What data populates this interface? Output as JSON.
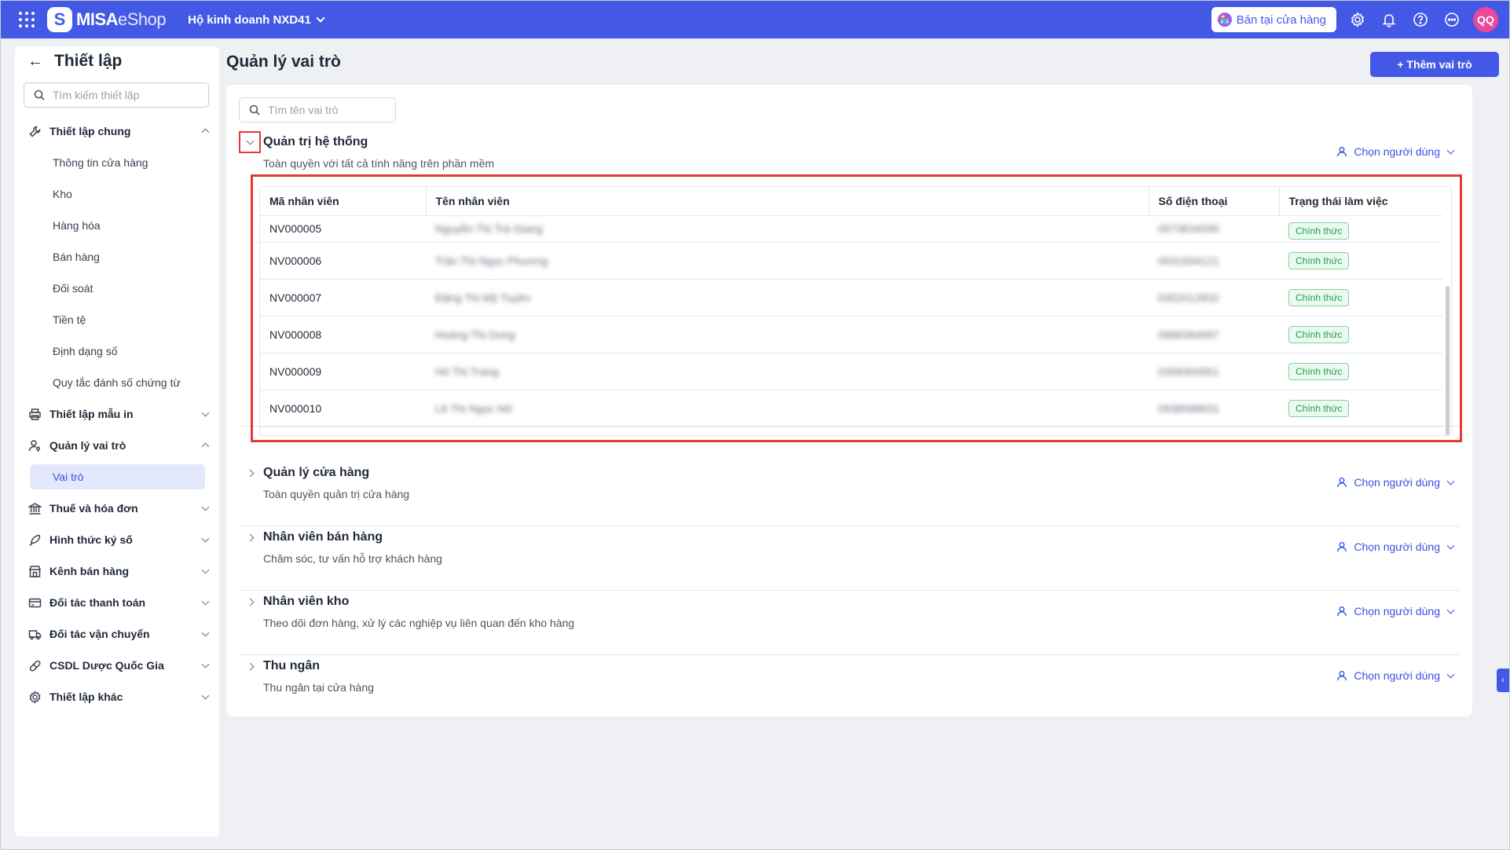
{
  "topbar": {
    "brand_main": "MISA",
    "brand_sub": "eShop",
    "business_name": "Hộ kinh doanh NXD41",
    "sell_button_label": "Bán tại cửa hàng",
    "avatar_initials": "QQ",
    "color": "#4359e6"
  },
  "sidebar": {
    "title": "Thiết lập",
    "search_placeholder": "Tìm kiếm thiết lập",
    "general_label": "Thiết lập chung",
    "general_items": [
      "Thông tin cửa hàng",
      "Kho",
      "Hàng hóa",
      "Bán hàng",
      "Đối soát",
      "Tiền tệ",
      "Định dạng số",
      "Quy tắc đánh số chứng từ"
    ],
    "print_label": "Thiết lập mẫu in",
    "roles_label": "Quản lý vai trò",
    "roles_sub": "Vai trò",
    "groups_after": [
      "Thuế và hóa đơn",
      "Hình thức ký số",
      "Kênh bán hàng",
      "Đối tác thanh toán",
      "Đối tác vận chuyển",
      "CSDL Dược Quốc Gia",
      "Thiết lập khác"
    ]
  },
  "main": {
    "page_title": "Quản lý vai trò",
    "add_role_label": "+ Thêm vai trò",
    "role_search_placeholder": "Tìm tên vai trò",
    "choose_user_label": "Chọn người dùng",
    "roles": [
      {
        "name": "Quản trị hệ thống",
        "desc": "Toàn quyền với tất cả tính năng trên phần mềm"
      },
      {
        "name": "Quản lý cửa hàng",
        "desc": "Toàn quyền quản trị cửa hàng"
      },
      {
        "name": "Nhân viên bán hàng",
        "desc": "Chăm sóc, tư vấn hỗ trợ khách hàng"
      },
      {
        "name": "Nhân viên kho",
        "desc": "Theo dõi đơn hàng, xử lý các nghiệp vụ liên quan đến kho hàng"
      },
      {
        "name": "Thu ngân",
        "desc": "Thu ngân tại cửa hàng"
      }
    ],
    "table": {
      "columns": [
        "Mã nhân viên",
        "Tên nhân viên",
        "Số điện thoại",
        "Trạng thái làm việc"
      ],
      "rows": [
        {
          "code": "NV000005",
          "name": "Nguyễn Thị Trà Giang",
          "phone": "0973834595",
          "status": "Chính thức"
        },
        {
          "code": "NV000006",
          "name": "Trần Thị Ngọc Phương",
          "phone": "0931934121",
          "status": "Chính thức"
        },
        {
          "code": "NV000007",
          "name": "Đặng Thị Mỹ Tuyền",
          "phone": "0352012832",
          "status": "Chính thức"
        },
        {
          "code": "NV000008",
          "name": "Hoàng Thị Dung",
          "phone": "0988384997",
          "status": "Chính thức"
        },
        {
          "code": "NV000009",
          "name": "Hồ Thị Trang",
          "phone": "0358300951",
          "status": "Chính thức"
        },
        {
          "code": "NV000010",
          "name": "Lê Thị Ngọc Nữ",
          "phone": "0938588831",
          "status": "Chính thức"
        }
      ]
    }
  }
}
